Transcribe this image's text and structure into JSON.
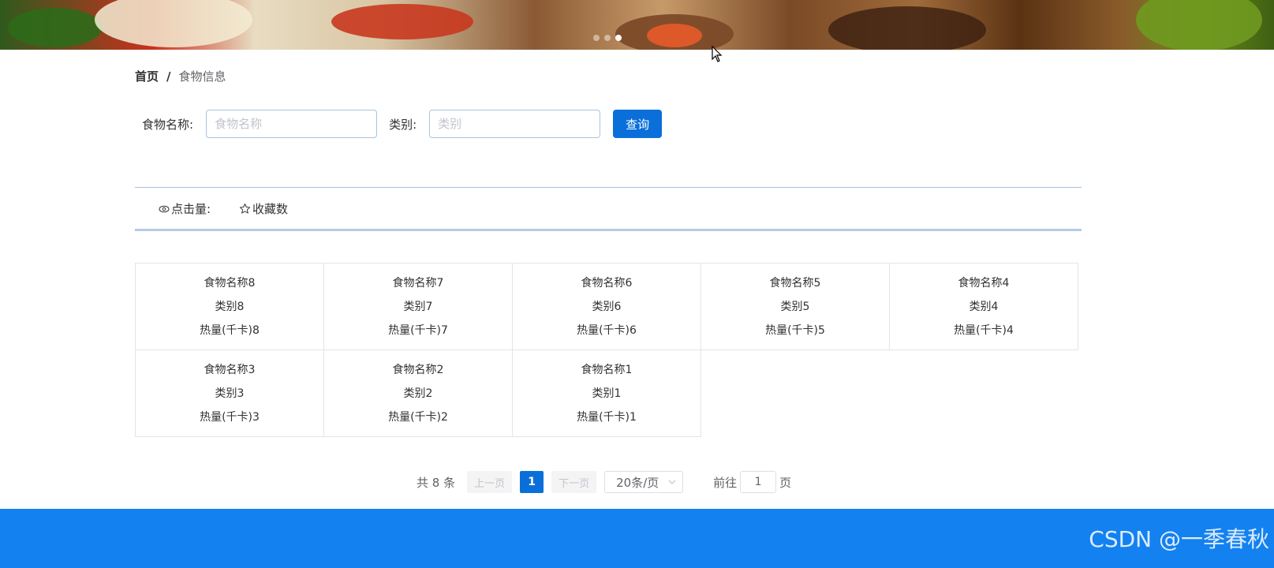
{
  "banner": {
    "carousel_count": 3,
    "active_index": 2
  },
  "breadcrumb": {
    "home": "首页",
    "separator": "/",
    "current": "食物信息"
  },
  "search": {
    "name_label": "食物名称:",
    "name_placeholder": "食物名称",
    "category_label": "类别:",
    "category_placeholder": "类别",
    "query_button": "查询"
  },
  "sort": {
    "views_label": "点击量:",
    "favorites_label": "收藏数"
  },
  "foods": [
    {
      "name": "食物名称8",
      "category": "类别8",
      "calories": "热量(千卡)8"
    },
    {
      "name": "食物名称7",
      "category": "类别7",
      "calories": "热量(千卡)7"
    },
    {
      "name": "食物名称6",
      "category": "类别6",
      "calories": "热量(千卡)6"
    },
    {
      "name": "食物名称5",
      "category": "类别5",
      "calories": "热量(千卡)5"
    },
    {
      "name": "食物名称4",
      "category": "类别4",
      "calories": "热量(千卡)4"
    },
    {
      "name": "食物名称3",
      "category": "类别3",
      "calories": "热量(千卡)3"
    },
    {
      "name": "食物名称2",
      "category": "类别2",
      "calories": "热量(千卡)2"
    },
    {
      "name": "食物名称1",
      "category": "类别1",
      "calories": "热量(千卡)1"
    }
  ],
  "pagination": {
    "total": "共 8 条",
    "prev": "上一页",
    "current_page": "1",
    "next": "下一页",
    "page_size": "20条/页",
    "goto_label": "前往",
    "goto_value": "1",
    "goto_suffix": "页"
  },
  "footer": {
    "watermark": "CSDN @一季春秋"
  },
  "colors": {
    "primary": "#0a6fd9",
    "footer": "#1381f0",
    "border": "#e4e4e4"
  }
}
